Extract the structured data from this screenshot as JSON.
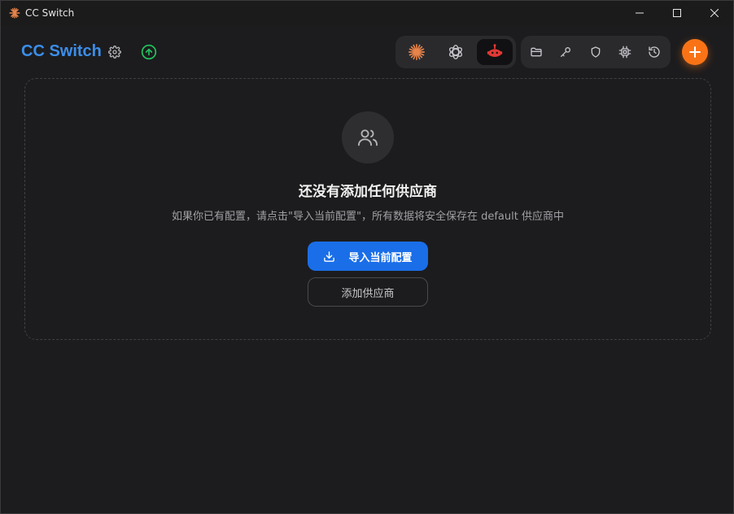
{
  "window": {
    "title": "CC Switch"
  },
  "header": {
    "brand": "CC Switch",
    "icons": {
      "settings": "gear-icon",
      "update": "arrow-up-circle-icon"
    },
    "app_switch": [
      {
        "name": "claude",
        "icon": "claude-sunburst-icon",
        "active": false
      },
      {
        "name": "codex",
        "icon": "openai-knot-icon",
        "active": false
      },
      {
        "name": "gemini",
        "icon": "red-robot-icon",
        "active": true
      }
    ],
    "tools": [
      "folder-icon",
      "key-icon",
      "shield-icon",
      "chip-icon",
      "history-icon"
    ],
    "add_icon": "plus-icon"
  },
  "empty_state": {
    "icon": "users-icon",
    "title": "还没有添加任何供应商",
    "description": "如果你已有配置，请点击\"导入当前配置\"，所有数据将安全保存在 default 供应商中",
    "import_button": "导入当前配置",
    "add_button": "添加供应商"
  },
  "colors": {
    "brand": "#3b8eea",
    "accent_orange": "#f97316",
    "primary_blue": "#1a6ee8",
    "update_green": "#22c55e",
    "background": "#1c1c1e"
  }
}
